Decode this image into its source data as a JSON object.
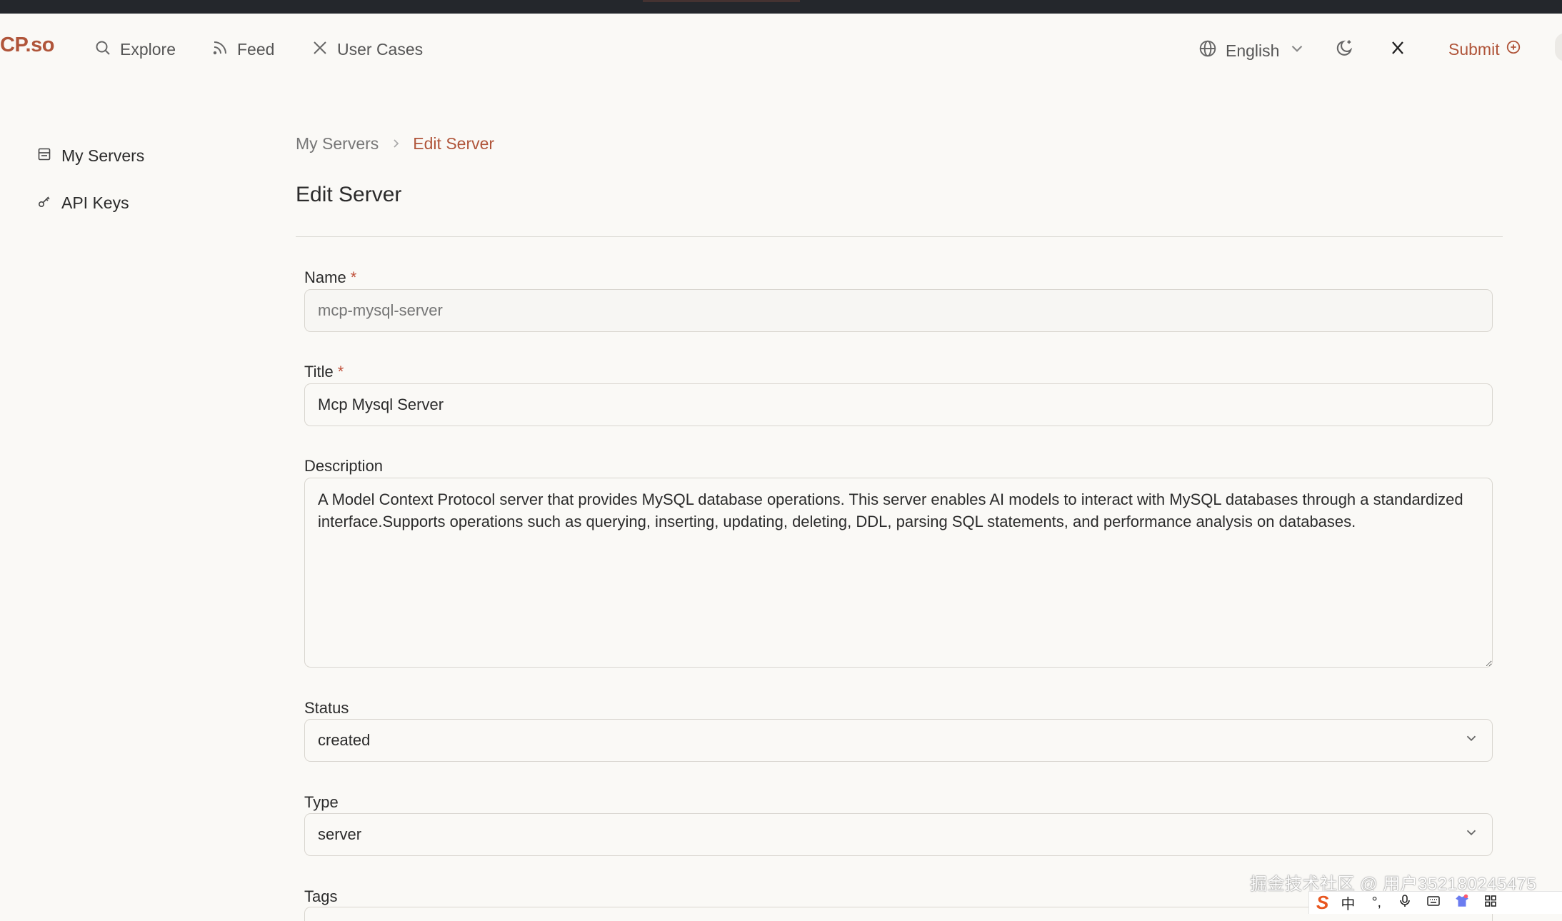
{
  "header": {
    "logo": "CP.so",
    "nav": [
      {
        "label": "Explore",
        "icon": "search-icon"
      },
      {
        "label": "Feed",
        "icon": "rss-icon"
      },
      {
        "label": "User Cases",
        "icon": "x-logo-icon"
      }
    ],
    "language": "English",
    "submit_label": "Submit"
  },
  "sidebar": {
    "items": [
      {
        "label": "My Servers",
        "icon": "server-list-icon"
      },
      {
        "label": "API Keys",
        "icon": "key-icon"
      }
    ]
  },
  "breadcrumb": {
    "parent": "My Servers",
    "current": "Edit Server"
  },
  "page_title": "Edit Server",
  "form": {
    "name": {
      "label": "Name",
      "required_mark": "*",
      "placeholder": "mcp-mysql-server"
    },
    "title": {
      "label": "Title",
      "required_mark": "*",
      "value": "Mcp Mysql Server"
    },
    "description": {
      "label": "Description",
      "value": "A Model Context Protocol server that provides MySQL database operations. This server enables AI models to interact with MySQL databases through a standardized interface.Supports operations such as querying, inserting, updating, deleting, DDL, parsing SQL statements, and performance analysis on databases."
    },
    "status": {
      "label": "Status",
      "value": "created"
    },
    "type": {
      "label": "Type",
      "value": "server"
    },
    "tags": {
      "label": "Tags"
    }
  },
  "watermark": "掘金技术社区 @ 用户352180245475",
  "ime_bar": {
    "logo": "S",
    "items": [
      "中",
      "°,",
      "mic-icon",
      "keyboard-icon",
      "shirt-icon",
      "grid-icon"
    ]
  },
  "colors": {
    "accent": "#b0553a",
    "background": "#faf9f6",
    "topbar": "#24272c"
  }
}
